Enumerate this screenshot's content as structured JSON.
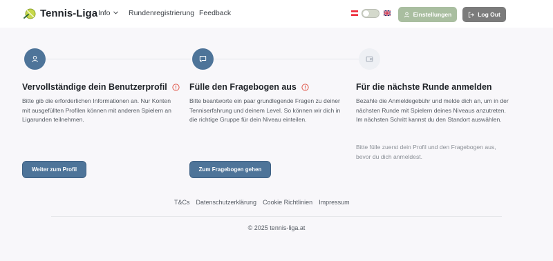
{
  "header": {
    "brand": "Tennis-Liga",
    "nav": {
      "info": "Info",
      "round_registration": "Rundenregistrierung",
      "feedback": "Feedback"
    },
    "settings_label": "Einstellungen",
    "logout_label": "Log Out",
    "languages": [
      "at",
      "uk"
    ],
    "accent_color": "#4e7499"
  },
  "steps": [
    {
      "title": "Vervollständige dein Benutzerprofil",
      "description": "Bitte gib die erforderlichen Informationen an. Nur Konten mit ausgefüllten Profilen können mit anderen Spielern an Ligarunden teilnehmen.",
      "button": "Weiter zum Profil",
      "icon": "user-icon",
      "status": "incomplete"
    },
    {
      "title": "Fülle den Fragebogen aus",
      "description": "Bitte beantworte ein paar grundlegende Fragen zu deiner Tenniserfahrung und deinem Level. So können wir dich in die richtige Gruppe für dein Niveau einteilen.",
      "button": "Zum Fragebogen gehen",
      "icon": "message-icon",
      "status": "incomplete"
    },
    {
      "title": "Für die nächste Runde anmelden",
      "description": "Bezahle die Anmeldegebühr und melde dich an, um in der nächsten Runde mit Spielern deines Niveaus anzutreten. Im nächsten Schritt kannst du den Standort auswählen.",
      "note": "Bitte fülle zuerst dein Profil und den Fragebogen aus, bevor du dich anmeldest.",
      "icon": "wallet-icon",
      "status": "locked"
    }
  ],
  "footer": {
    "links": [
      "T&Cs",
      "Datenschutzerklärung",
      "Cookie Richtlinien",
      "Impressum"
    ],
    "copyright": "© 2025 tennis-liga.at"
  }
}
